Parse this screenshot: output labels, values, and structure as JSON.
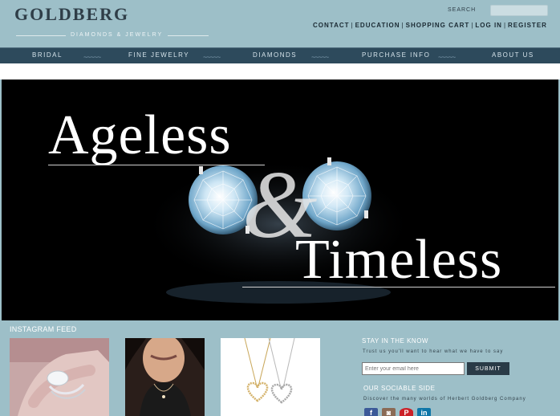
{
  "header": {
    "logo_main": "GOLDBERG",
    "logo_sub": "DIAMONDS & JEWELRY",
    "search_label": "SEARCH",
    "search_placeholder": "",
    "links": [
      "CONTACT",
      "EDUCATION",
      "SHOPPING CART",
      "LOG IN",
      "REGISTER"
    ]
  },
  "nav": {
    "items": [
      "BRIDAL",
      "FINE JEWELRY",
      "DIAMONDS",
      "PURCHASE INFO",
      "ABOUT US"
    ],
    "wave": "~~~~~"
  },
  "hero": {
    "line1": "Ageless",
    "ampersand": "&",
    "line2": "Timeless"
  },
  "instagram": {
    "title": "INSTAGRAM FEED"
  },
  "newsletter": {
    "title": "STAY IN THE KNOW",
    "text": "Trust us you'll want to hear what we have to say",
    "email_placeholder": "Enter your email here",
    "submit_label": "SUBMIT"
  },
  "social": {
    "title": "OUR SOCIABLE SIDE",
    "text": "Discover the many worlds of Herbert Goldberg Company",
    "icons": [
      {
        "name": "facebook-icon",
        "glyph": "f",
        "color": "#3b5998"
      },
      {
        "name": "instagram-icon",
        "glyph": "◙",
        "color": "#8a6a55"
      },
      {
        "name": "pinterest-icon",
        "glyph": "P",
        "color": "#cb2027"
      },
      {
        "name": "linkedin-icon",
        "glyph": "in",
        "color": "#0e76a8"
      }
    ]
  },
  "colors": {
    "background": "#9dbfc8",
    "nav": "#2d4a5c",
    "button": "#2a3b47"
  }
}
